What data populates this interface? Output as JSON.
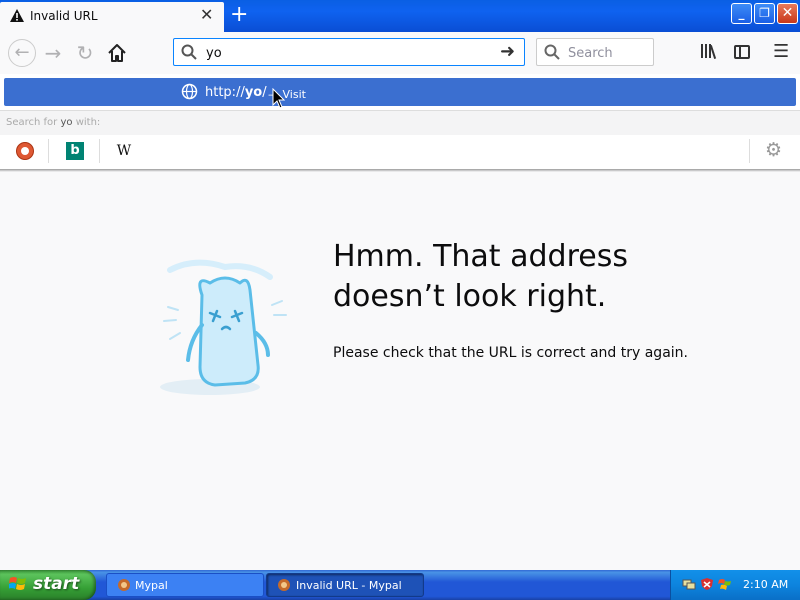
{
  "tab": {
    "title": "Invalid URL",
    "close": "✕",
    "new_tab": "+"
  },
  "window": {
    "minimize": "_",
    "maximize": "❐",
    "close": "✕"
  },
  "nav": {
    "url_value": "yo",
    "search_placeholder": "Search"
  },
  "popup": {
    "suggestion_url_prefix": "http://",
    "suggestion_url_bold": "yo",
    "suggestion_url_suffix": "/",
    "suggestion_action": "— Visit",
    "search_for_prefix": "Search for ",
    "search_for_term": "yo",
    "search_for_suffix": " with:",
    "engines": [
      {
        "name": "duckduckgo-icon"
      },
      {
        "name": "bing-icon",
        "glyph": "b"
      },
      {
        "name": "wikipedia-icon",
        "glyph": "W"
      }
    ]
  },
  "error": {
    "title_line1": "Hmm. That address",
    "title_line2": "doesn’t look right.",
    "description": "Please check that the URL is correct and try again."
  },
  "taskbar": {
    "start_label": "start",
    "tasks": [
      {
        "label": "Mypal"
      },
      {
        "label": "Invalid URL - Mypal"
      }
    ],
    "clock": "2:10 AM"
  },
  "colors": {
    "accent": "#0a84ff",
    "suggestion_highlight": "#3b6fd0",
    "xp_blue": "#2157d6",
    "xp_start_green": "#36a036"
  }
}
